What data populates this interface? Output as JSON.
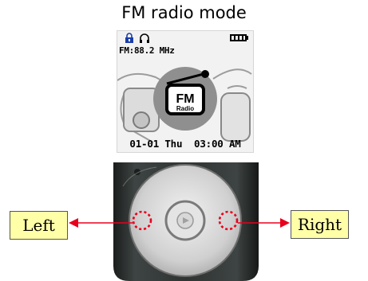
{
  "title": "FM radio mode",
  "screen": {
    "frequency": "FM:88.2 MHz",
    "badge_main": "FM",
    "badge_sub": "Radio",
    "datetime": "01-01 Thu  03:00 AM",
    "icons": [
      "lock-icon",
      "headphones-icon",
      "battery-full-icon",
      "radio-icon"
    ]
  },
  "labels": {
    "left": "Left",
    "right": "Right"
  },
  "colors": {
    "label_bg": "#ffffa8",
    "arrow": "#e8001c",
    "highlight_circle": "#e8001c",
    "device_body": "#2f3433"
  }
}
